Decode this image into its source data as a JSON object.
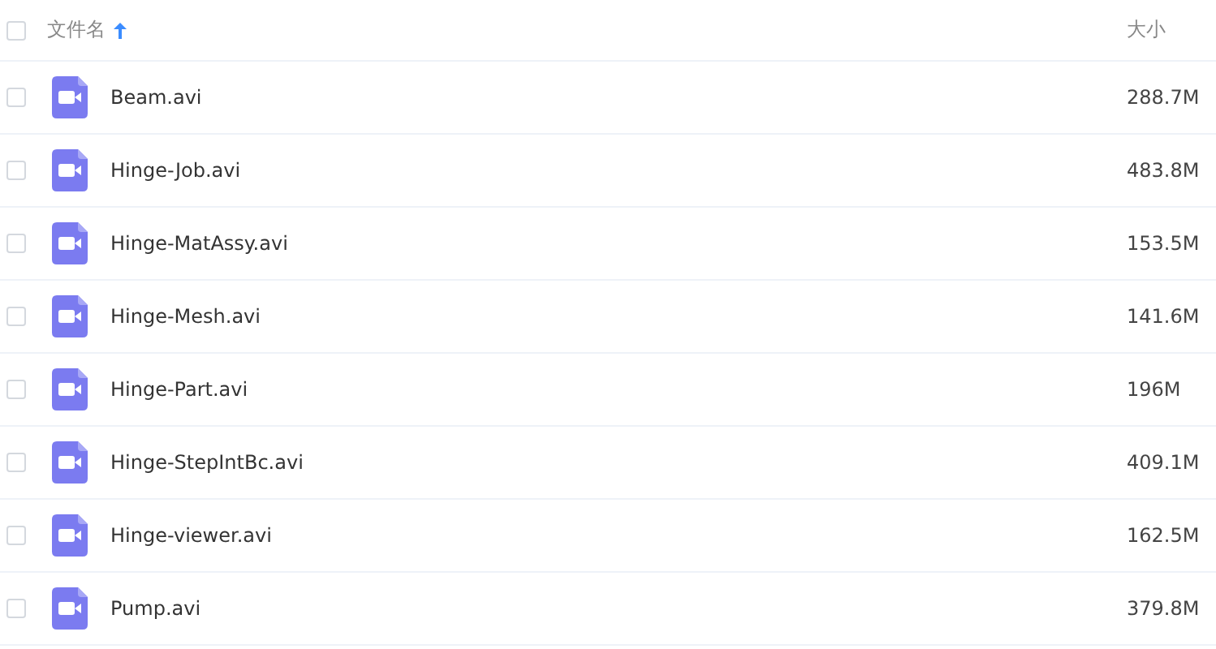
{
  "header": {
    "checked": false,
    "columns": [
      {
        "label": "文件名",
        "sorted": true,
        "ascending": true
      },
      {
        "label": "大小"
      }
    ]
  },
  "rows": [
    {
      "name": "Beam.avi",
      "size": "288.7M",
      "checked": false
    },
    {
      "name": "Hinge-Job.avi",
      "size": "483.8M",
      "checked": false
    },
    {
      "name": "Hinge-MatAssy.avi",
      "size": "153.5M",
      "checked": false
    },
    {
      "name": "Hinge-Mesh.avi",
      "size": "141.6M",
      "checked": false
    },
    {
      "name": "Hinge-Part.avi",
      "size": "196M",
      "checked": false
    },
    {
      "name": "Hinge-StepIntBc.avi",
      "size": "409.1M",
      "checked": false
    },
    {
      "name": "Hinge-viewer.avi",
      "size": "162.5M",
      "checked": false
    },
    {
      "name": "Pump.avi",
      "size": "379.8M",
      "checked": false
    }
  ]
}
